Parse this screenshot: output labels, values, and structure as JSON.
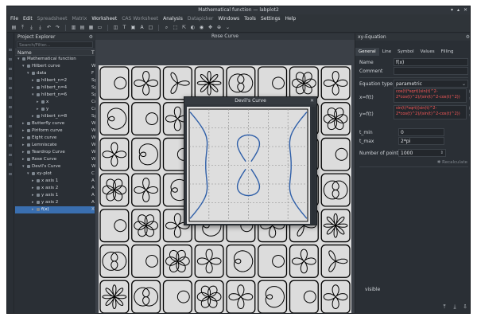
{
  "window": {
    "title": "Mathematical function — labplot2"
  },
  "menubar": {
    "items": [
      {
        "label": "File",
        "enabled": true
      },
      {
        "label": "Edit",
        "enabled": true
      },
      {
        "label": "Spreadsheet",
        "enabled": false
      },
      {
        "label": "Matrix",
        "enabled": false
      },
      {
        "label": "Worksheet",
        "enabled": true
      },
      {
        "label": "CAS Worksheet",
        "enabled": false
      },
      {
        "label": "Analysis",
        "enabled": true
      },
      {
        "label": "Datapicker",
        "enabled": false
      },
      {
        "label": "Windows",
        "enabled": true
      },
      {
        "label": "Tools",
        "enabled": true
      },
      {
        "label": "Settings",
        "enabled": true
      },
      {
        "label": "Help",
        "enabled": true
      }
    ]
  },
  "explorer": {
    "title": "Project Explorer",
    "search_placeholder": "Search/Filter...",
    "columns": [
      "Name",
      "T"
    ],
    "rows": [
      {
        "label": "Mathematical function",
        "level": 0,
        "expanded": true,
        "type": ""
      },
      {
        "label": "Hilbert curve",
        "level": 1,
        "expanded": true,
        "type": "W"
      },
      {
        "label": "data",
        "level": 2,
        "expanded": true,
        "type": "F"
      },
      {
        "label": "hilbert_n=2",
        "level": 3,
        "expanded": false,
        "type": "Sp"
      },
      {
        "label": "hilbert_n=4",
        "level": 3,
        "expanded": false,
        "type": "Sp"
      },
      {
        "label": "hilbert_n=6",
        "level": 3,
        "expanded": true,
        "type": "Sp"
      },
      {
        "label": "x",
        "level": 4,
        "expanded": false,
        "type": "Co"
      },
      {
        "label": "y",
        "level": 4,
        "expanded": false,
        "type": "Co"
      },
      {
        "label": "hilbert_n=8",
        "level": 3,
        "expanded": false,
        "type": "Sp"
      },
      {
        "label": "Butterfly curve",
        "level": 1,
        "expanded": false,
        "type": "W"
      },
      {
        "label": "Piriform curve",
        "level": 1,
        "expanded": false,
        "type": "W"
      },
      {
        "label": "Eight curve",
        "level": 1,
        "expanded": false,
        "type": "W"
      },
      {
        "label": "Lemniscate",
        "level": 1,
        "expanded": false,
        "type": "W"
      },
      {
        "label": "Teardrop Curve",
        "level": 1,
        "expanded": false,
        "type": "W"
      },
      {
        "label": "Rose Curve",
        "level": 1,
        "expanded": false,
        "type": "W"
      },
      {
        "label": "Devil's Curve",
        "level": 1,
        "expanded": true,
        "type": "W"
      },
      {
        "label": "xy-plot",
        "level": 2,
        "expanded": true,
        "type": "C"
      },
      {
        "label": "x axis 1",
        "level": 3,
        "expanded": false,
        "type": "A"
      },
      {
        "label": "x axis 2",
        "level": 3,
        "expanded": false,
        "type": "A"
      },
      {
        "label": "y axis 1",
        "level": 3,
        "expanded": false,
        "type": "A"
      },
      {
        "label": "y axis 2",
        "level": 3,
        "expanded": false,
        "type": "A"
      },
      {
        "label": "f(x)",
        "level": 3,
        "expanded": false,
        "type": "X",
        "selected": true
      }
    ]
  },
  "mdi": {
    "rose_title": "Rose Curve",
    "devil_title": "Devil's Curve"
  },
  "props": {
    "title": "xy-Equation",
    "tabs": [
      "General",
      "Line",
      "Symbol",
      "Values",
      "Filling"
    ],
    "active_tab": "General",
    "name_label": "Name",
    "name_value": "f(x)",
    "comment_label": "Comment",
    "equation_type_label": "Equation type",
    "equation_type_value": "parametric",
    "x_label": "x=f(t)",
    "x_expr": "cos(t)*sqrt((sin(t)^2-2*cos(t)^2)/(sin(t)^2-cos(t)^2))",
    "y_label": "y=f(t)",
    "y_expr": "sin(t)*sqrt((sin(t)^2-2*cos(t)^2)/(sin(t)^2-cos(t)^2))",
    "tmin_label": "t_min",
    "tmin_value": "0",
    "tmax_label": "t_max",
    "tmax_value": "2*pi",
    "npoints_label": "Number of points",
    "npoints_value": "1000",
    "recalculate_label": "Recalculate",
    "visible_label": "visible"
  },
  "colors": {
    "accent": "#3a6fb0",
    "curve": "#2f5fa8",
    "expression": "#ff5a5a"
  }
}
